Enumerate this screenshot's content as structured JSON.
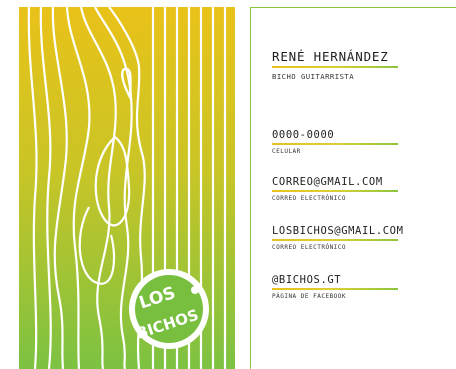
{
  "front": {
    "logo": {
      "line1": "LOS",
      "line2": "BICHOS"
    },
    "colors": {
      "top": "#e9c219",
      "bottom": "#7cc242",
      "stroke": "#ffffff"
    }
  },
  "back": {
    "name": "RENÉ HERNÁNDEZ",
    "role": "BICHO GUITARRISTA",
    "phone": {
      "value": "0000-0000",
      "label": "CELULAR"
    },
    "email_personal": {
      "value": "CORREO@GMAIL.COM",
      "label": "CORREO ELECTRÓNICO"
    },
    "email_band": {
      "value": "LOSBICHOS@GMAIL.COM",
      "label": "CORREO ELECTRÓNICO"
    },
    "facebook": {
      "value": "@BICHOS.GT",
      "label": "PÁGINA DE FACEBOOK"
    },
    "accent": "#8cc63f"
  }
}
